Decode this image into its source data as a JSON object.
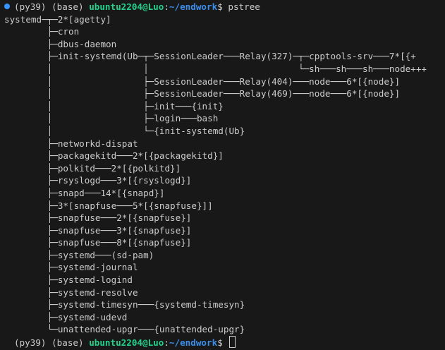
{
  "prompt": {
    "env_py": "(py39)",
    "env_base": "(base)",
    "user_host": "ubuntu2204@Luo",
    "separator": ":",
    "path": "~/endwork",
    "dollar": "$",
    "command": "pstree"
  },
  "tree_lines": [
    "systemd─┬─2*[agetty]",
    "        ├─cron",
    "        ├─dbus-daemon",
    "        ├─init-systemd(Ub─┬─SessionLeader───Relay(327)─┬─cpptools-srv───7*[{+",
    "        │                 │                            └─sh───sh───sh───node+++",
    "        │                 ├─SessionLeader───Relay(404)───node───6*[{node}]",
    "        │                 ├─SessionLeader───Relay(469)───node───6*[{node}]",
    "        │                 ├─init───{init}",
    "        │                 ├─login───bash",
    "        │                 └─{init-systemd(Ub}",
    "        ├─networkd-dispat",
    "        ├─packagekitd───2*[{packagekitd}]",
    "        ├─polkitd───2*[{polkitd}]",
    "        ├─rsyslogd───3*[{rsyslogd}]",
    "        ├─snapd───14*[{snapd}]",
    "        ├─3*[snapfuse───5*[{snapfuse}]]",
    "        ├─snapfuse───2*[{snapfuse}]",
    "        ├─snapfuse───3*[{snapfuse}]",
    "        ├─snapfuse───8*[{snapfuse}]",
    "        ├─systemd───(sd-pam)",
    "        ├─systemd-journal",
    "        ├─systemd-logind",
    "        ├─systemd-resolve",
    "        ├─systemd-timesyn───{systemd-timesyn}",
    "        ├─systemd-udevd",
    "        └─unattended-upgr───{unattended-upgr}"
  ],
  "colors": {
    "background": "#181818",
    "text": "#cccccc",
    "user_host": "#23d18b",
    "path": "#3b8eea",
    "status_dot": "#3794ff"
  }
}
